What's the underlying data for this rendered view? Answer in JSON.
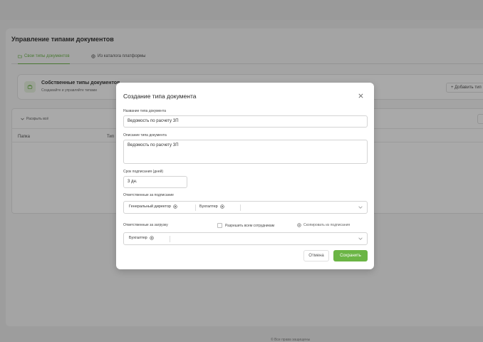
{
  "page": {
    "title": "Управление типами документов",
    "tabs": [
      {
        "label": "Свои типы документов",
        "icon": "folder-icon",
        "active": true
      },
      {
        "label": "Из каталога платформы",
        "icon": "globe-icon",
        "active": false
      }
    ],
    "card": {
      "title": "Собственные типы документов",
      "subtitle": "Создавайте и управляйте типами"
    },
    "add_button": "+ Добавить тип",
    "expand_all": "Раскрыть всё",
    "columns": [
      "Папка",
      "Тип"
    ],
    "footer": "© Все права защищены"
  },
  "modal": {
    "title": "Создание типа документа",
    "name_label": "Название типа документа",
    "name_value": "Ведомость по расчету ЗП",
    "desc_label": "Описание типа документа",
    "desc_value": "Ведомость по расчету ЗП",
    "term_label": "Срок подписания (дней)",
    "term_value": "3 дн.",
    "signers_label": "Ответственные за подписание",
    "signers": [
      "Генеральный директор",
      "Бухгалтер"
    ],
    "uploaders_label": "Ответственные за загрузку",
    "allow_all_label": "Разрешить всем сотрудникам",
    "allow_all_checked": false,
    "copy_label": "Скопировать из подписания",
    "uploaders": [
      "Бухгалтер"
    ],
    "cancel_label": "Отмена",
    "save_label": "Сохранить"
  },
  "colors": {
    "accent": "#6bb545",
    "accent_text": "#5fae3a"
  }
}
